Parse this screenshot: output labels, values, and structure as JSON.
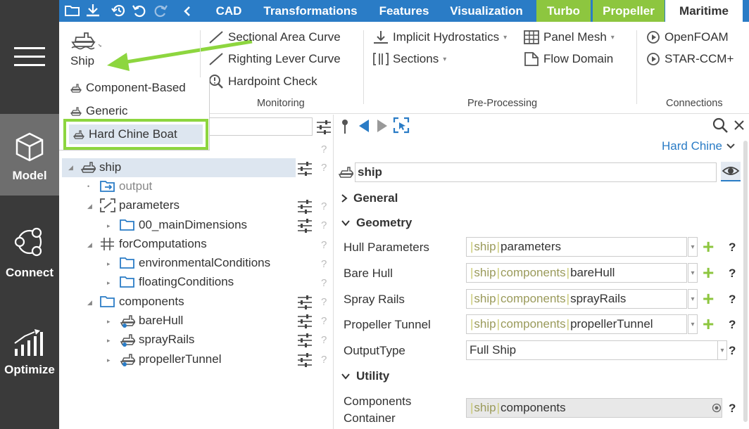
{
  "rail": {
    "items": [
      {
        "label": "Model",
        "active": true
      },
      {
        "label": "Connect",
        "active": false
      },
      {
        "label": "Optimize",
        "active": false
      }
    ]
  },
  "topbar": {
    "tabs": [
      "CAD",
      "Transformations",
      "Features",
      "Visualization",
      "Turbo",
      "Propeller",
      "Maritime"
    ],
    "active_tab": "Maritime"
  },
  "ribbon": {
    "ship_label": "Ship",
    "monitoring": {
      "group": "Monitoring",
      "items": [
        "Sectional Area Curve",
        "Righting Lever Curve",
        "Hardpoint Check"
      ]
    },
    "preprocessing": {
      "group": "Pre-Processing",
      "items": [
        "Implicit Hydrostatics",
        "Sections",
        "Panel Mesh",
        "Flow Domain"
      ]
    },
    "connections": {
      "group": "Connections",
      "items": [
        "OpenFOAM",
        "STAR-CCM+"
      ]
    }
  },
  "dropdown": {
    "items": [
      "Component-Based",
      "Generic"
    ],
    "highlighted": "Hard Chine Boat"
  },
  "tree": {
    "nodes": [
      {
        "label": "ship"
      },
      {
        "label": "output"
      },
      {
        "label": "parameters"
      },
      {
        "label": "00_mainDimensions"
      },
      {
        "label": "forComputations"
      },
      {
        "label": "environmentalConditions"
      },
      {
        "label": "floatingConditions"
      },
      {
        "label": "components"
      },
      {
        "label": "bareHull"
      },
      {
        "label": "sprayRails"
      },
      {
        "label": "propellerTunnel"
      }
    ],
    "help": "?"
  },
  "panel": {
    "type_selector": "Hard Chine",
    "object_name": "ship",
    "sections": {
      "general": "General",
      "geometry": "Geometry",
      "utility": "Utility"
    },
    "rows": [
      {
        "label": "Hull Parameters",
        "path": [
          "ship",
          "parameters"
        ]
      },
      {
        "label": "Bare Hull",
        "path": [
          "ship",
          "components",
          "bareHull"
        ]
      },
      {
        "label": "Spray Rails",
        "path": [
          "ship",
          "components",
          "sprayRails"
        ]
      },
      {
        "label": "Propeller Tunnel",
        "path": [
          "ship",
          "components",
          "propellerTunnel"
        ]
      }
    ],
    "output_type": {
      "label": "OutputType",
      "value": "Full Ship"
    },
    "components_container": {
      "label_line1": "Components",
      "label_line2": "Container",
      "path": [
        "ship",
        "components"
      ]
    },
    "help": "?"
  },
  "colors": {
    "topbar_blue": "#2a7cc6",
    "tab_green": "#8dc63f",
    "highlight_green": "#8dd63f",
    "rail_dark": "#3a3a3a",
    "accent_blue": "#2a7cc6"
  }
}
